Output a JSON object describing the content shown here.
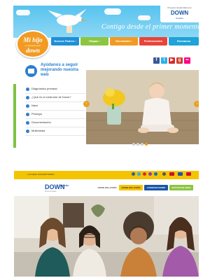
{
  "shot1": {
    "logo": {
      "line1": "Mi hijo",
      "line2": "un pequeño gran",
      "line3": "down"
    },
    "tagline": "Contigo desde el primer momento",
    "sponsor": {
      "top": "Proyecto desarrollado por",
      "name": "DOWN",
      "sub": "España"
    },
    "nav": [
      {
        "label": "Nuevos Padres ›",
        "color": "#1f8fd8"
      },
      {
        "label": "Etapas ›",
        "color": "#8cc63f"
      },
      {
        "label": "Novedades ›",
        "color": "#f29a22"
      },
      {
        "label": "Profesionales",
        "color": "#e8443a"
      },
      {
        "label": "Hermanos",
        "color": "#1fa3d8"
      }
    ],
    "social": [
      {
        "icon": "facebook-icon",
        "glyph": "f",
        "color": "#3b5998"
      },
      {
        "icon": "twitter-icon",
        "glyph": "t",
        "color": "#29b2e8"
      },
      {
        "icon": "youtube-icon",
        "glyph": "▶",
        "color": "#d62b2b"
      },
      {
        "icon": "google-plus-icon",
        "glyph": "g",
        "color": "#d0412f"
      },
      {
        "icon": "flickr-icon",
        "glyph": "••",
        "color": "#ff0084"
      }
    ],
    "help_text": "Ayúdanos a seguir mejorando nuestra web",
    "menu": [
      "Diagnóstico prenatal",
      "¿Qué es el síndrome de Down?",
      "Nace",
      "Pelonga",
      "Documentación",
      "Multimedia"
    ],
    "hero_arrows": {
      "prev": "‹",
      "next": "›"
    },
    "slide_count": 4,
    "colors": {
      "header": "#57c3ee",
      "accent": "#f29a22",
      "menu_bullet": "#2c7fd1",
      "sidebar": "#7dc142"
    }
  },
  "shot2": {
    "topbar_left": "+ ACCESO SUSCRIPTORES",
    "logo": {
      "a": "DOWN",
      "b": "ESPAÑA",
      "c": "Plena inclusión"
    },
    "nav": [
      {
        "label": "DOWN INCLUSIÓN",
        "bg": "#ffffff",
        "fg": "#555555"
      },
      {
        "label": "DOWN INCLUSIÓN",
        "bg": "#f5c400",
        "fg": "#333333"
      },
      {
        "label": "CONOCER DOWN",
        "bg": "#1a56a6",
        "fg": "#ffffff"
      },
      {
        "label": "APOYOS EN LÍNEA",
        "bg": "#8cc63f",
        "fg": "#ffffff"
      }
    ],
    "colors": {
      "topbar": "#f5c400",
      "brand": "#1a56a6"
    }
  }
}
